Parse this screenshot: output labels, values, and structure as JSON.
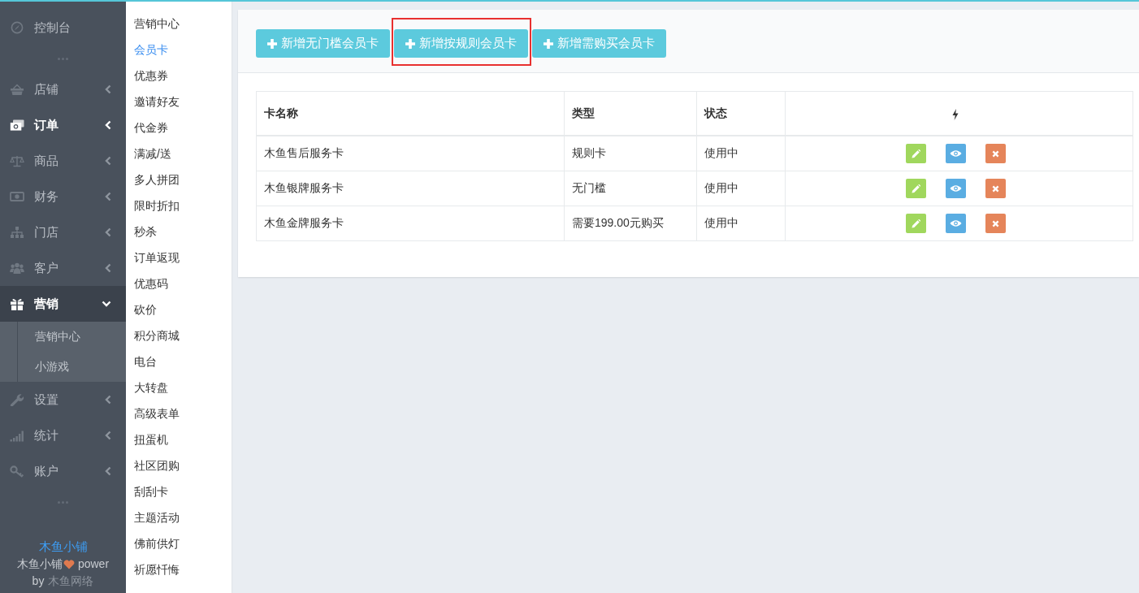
{
  "sidebar": {
    "items": [
      {
        "kind": "link",
        "label": "控制台",
        "highlighted": false
      },
      {
        "kind": "dots"
      },
      {
        "kind": "menu",
        "label": "店铺",
        "highlighted": false,
        "expanded": false
      },
      {
        "kind": "menu",
        "label": "订单",
        "highlighted": true,
        "expanded": false
      },
      {
        "kind": "menu",
        "label": "商品",
        "highlighted": false,
        "expanded": false
      },
      {
        "kind": "menu",
        "label": "财务",
        "highlighted": false,
        "expanded": false
      },
      {
        "kind": "menu",
        "label": "门店",
        "highlighted": false,
        "expanded": false
      },
      {
        "kind": "menu",
        "label": "客户",
        "highlighted": false,
        "expanded": false
      },
      {
        "kind": "menu",
        "label": "营销",
        "highlighted": false,
        "expanded": true,
        "children": [
          {
            "label": "营销中心"
          },
          {
            "label": "小游戏"
          }
        ]
      },
      {
        "kind": "menu",
        "label": "设置",
        "highlighted": false,
        "expanded": false
      },
      {
        "kind": "menu",
        "label": "统计",
        "highlighted": false,
        "expanded": false
      },
      {
        "kind": "menu",
        "label": "账户",
        "highlighted": false,
        "expanded": false
      },
      {
        "kind": "dots"
      }
    ],
    "footer": {
      "brand": "木鱼小铺",
      "credit_name": "木鱼小铺",
      "credit_suffix": "power",
      "by": "by",
      "author": "木鱼网络"
    }
  },
  "submenu": {
    "items": [
      {
        "label": "营销中心",
        "selected": false
      },
      {
        "label": "会员卡",
        "selected": true
      },
      {
        "label": "优惠券",
        "selected": false
      },
      {
        "label": "邀请好友",
        "selected": false
      },
      {
        "label": "代金券",
        "selected": false
      },
      {
        "label": "满减/送",
        "selected": false
      },
      {
        "label": "多人拼团",
        "selected": false
      },
      {
        "label": "限时折扣",
        "selected": false
      },
      {
        "label": "秒杀",
        "selected": false
      },
      {
        "label": "订单返现",
        "selected": false
      },
      {
        "label": "优惠码",
        "selected": false
      },
      {
        "label": "砍价",
        "selected": false
      },
      {
        "label": "积分商城",
        "selected": false
      },
      {
        "label": "电台",
        "selected": false
      },
      {
        "label": "大转盘",
        "selected": false
      },
      {
        "label": "高级表单",
        "selected": false
      },
      {
        "label": "扭蛋机",
        "selected": false
      },
      {
        "label": "社区团购",
        "selected": false
      },
      {
        "label": "刮刮卡",
        "selected": false
      },
      {
        "label": "主题活动",
        "selected": false
      },
      {
        "label": "佛前供灯",
        "selected": false
      },
      {
        "label": "祈愿忏悔",
        "selected": false
      }
    ]
  },
  "toolbar": {
    "buttons": [
      {
        "label": "新增无门槛会员卡",
        "highlighted": false
      },
      {
        "label": "新增按规则会员卡",
        "highlighted": true
      },
      {
        "label": "新增需购买会员卡",
        "highlighted": false
      }
    ]
  },
  "table": {
    "columns": [
      "卡名称",
      "类型",
      "状态"
    ],
    "rows": [
      {
        "cells": [
          "木鱼售后服务卡",
          "规则卡",
          "使用中"
        ]
      },
      {
        "cells": [
          "木鱼银牌服务卡",
          "无门槛",
          "使用中"
        ]
      },
      {
        "cells": [
          "木鱼金牌服务卡",
          "需要199.00元购买",
          "使用中"
        ]
      }
    ]
  }
}
